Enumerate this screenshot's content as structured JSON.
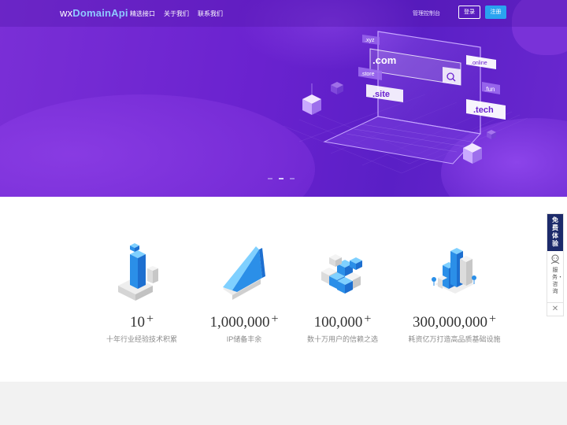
{
  "nav": {
    "logo_prefix": "wx",
    "logo_brand": "DomainApi",
    "links": [
      "精选接口",
      "关于我们",
      "联系我们"
    ],
    "console": "管理控制台",
    "login": "登录",
    "register": "注册"
  },
  "hero": {
    "domains": [
      ".xyz",
      ".com",
      ".store",
      ".site",
      ".online",
      ".fun",
      ".tech"
    ],
    "carousel_count": 3,
    "active_slide": 2
  },
  "features": [
    {
      "number": "10",
      "plus": "+",
      "desc": "十年行业经验技术积累"
    },
    {
      "number": "1,000,000",
      "plus": "+",
      "desc": "IP储备丰余"
    },
    {
      "number": "100,000",
      "plus": "+",
      "desc": "数十万用户的信赖之选"
    },
    {
      "number": "300,000,000",
      "plus": "+",
      "desc": "耗资亿万打造高品质基础设施"
    }
  ],
  "side_widget": {
    "trial": "免费体验",
    "service": "服务・咨询",
    "close": "✕"
  },
  "colors": {
    "hero_primary": "#6a22cf",
    "register_button": "#2aa3f0",
    "feature_blue": "#2b8fe8",
    "widget_dark": "#1c2a6a"
  }
}
